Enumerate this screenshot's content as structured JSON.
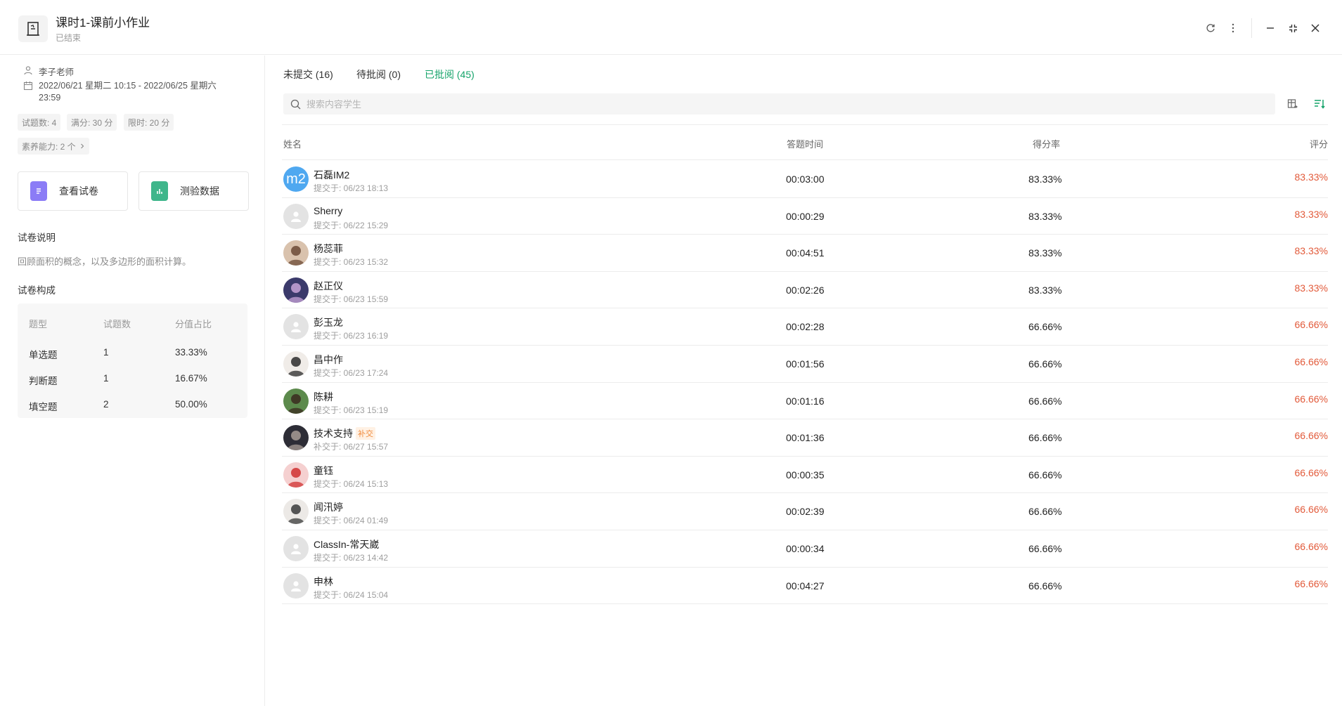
{
  "header": {
    "title": "课时1-课前小作业",
    "status": "已结束"
  },
  "info": {
    "teacher": "李子老师",
    "time_range_line1": "2022/06/21 星期二 10:15 - 2022/06/25 星期六",
    "time_range_line2": "23:59",
    "chips": {
      "count": "试题数: 4",
      "full_score": "满分: 30 分",
      "time_limit": "限时: 20 分",
      "literacy": "素养能力: 2 个"
    },
    "buttons": {
      "view_paper": "查看试卷",
      "quiz_data": "测验数据"
    },
    "desc_title": "试卷说明",
    "desc_text": "回顾面积的概念，以及多边形的面积计算。",
    "comp_title": "试卷构成",
    "comp_headers": [
      "题型",
      "试题数",
      "分值占比"
    ],
    "comp_rows": [
      {
        "type": "单选题",
        "count": "1",
        "ratio": "33.33%"
      },
      {
        "type": "判断题",
        "count": "1",
        "ratio": "16.67%"
      },
      {
        "type": "填空题",
        "count": "2",
        "ratio": "50.00%"
      }
    ]
  },
  "tabs": [
    {
      "label": "未提交 (16)"
    },
    {
      "label": "待批阅 (0)"
    },
    {
      "label": "已批阅 (45)"
    }
  ],
  "active_tab": 2,
  "search": {
    "placeholder": "搜索内容学生"
  },
  "table": {
    "headers": {
      "name": "姓名",
      "time": "答题时间",
      "rate": "得分率",
      "score": "评分"
    },
    "rows": [
      {
        "name": "石磊IM2",
        "submit": "提交于: 06/23 18:13",
        "time": "00:03:00",
        "rate": "83.33%",
        "score": "83.33%",
        "avatar": "m2"
      },
      {
        "name": "Sherry",
        "submit": "提交于: 06/22 15:29",
        "time": "00:00:29",
        "rate": "83.33%",
        "score": "83.33%",
        "avatar": "default"
      },
      {
        "name": "杨蕊菲",
        "submit": "提交于: 06/23 15:32",
        "time": "00:04:51",
        "rate": "83.33%",
        "score": "83.33%",
        "avatar": "photo-a"
      },
      {
        "name": "赵正仪",
        "submit": "提交于: 06/23 15:59",
        "time": "00:02:26",
        "rate": "83.33%",
        "score": "83.33%",
        "avatar": "photo-b"
      },
      {
        "name": "彭玉龙",
        "submit": "提交于: 06/23 16:19",
        "time": "00:02:28",
        "rate": "66.66%",
        "score": "66.66%",
        "avatar": "default"
      },
      {
        "name": "昌中作",
        "submit": "提交于: 06/23 17:24",
        "time": "00:01:56",
        "rate": "66.66%",
        "score": "66.66%",
        "avatar": "photo-c"
      },
      {
        "name": "陈耕",
        "submit": "提交于: 06/23 15:19",
        "time": "00:01:16",
        "rate": "66.66%",
        "score": "66.66%",
        "avatar": "photo-d"
      },
      {
        "name": "技术支持",
        "badge": "补交",
        "submit": "补交于: 06/27 15:57",
        "time": "00:01:36",
        "rate": "66.66%",
        "score": "66.66%",
        "avatar": "photo-e"
      },
      {
        "name": "童钰",
        "submit": "提交于: 06/24 15:13",
        "time": "00:00:35",
        "rate": "66.66%",
        "score": "66.66%",
        "avatar": "photo-f"
      },
      {
        "name": "闻汛婷",
        "submit": "提交于: 06/24 01:49",
        "time": "00:02:39",
        "rate": "66.66%",
        "score": "66.66%",
        "avatar": "photo-g"
      },
      {
        "name": "ClassIn-常天崴",
        "submit": "提交于: 06/23 14:42",
        "time": "00:00:34",
        "rate": "66.66%",
        "score": "66.66%",
        "avatar": "default"
      },
      {
        "name": "申林",
        "submit": "提交于: 06/24 15:04",
        "time": "00:04:27",
        "rate": "66.66%",
        "score": "66.66%",
        "avatar": "default"
      }
    ]
  },
  "colors": {
    "accent": "#15a36a",
    "score": "#e25a3a",
    "badge": "#f08b3d"
  }
}
